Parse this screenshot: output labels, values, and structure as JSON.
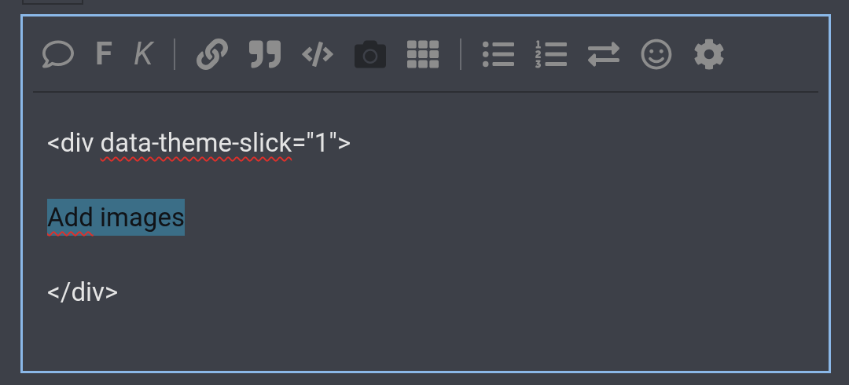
{
  "toolbar": [
    {
      "kind": "icon",
      "disabled": false
    },
    {
      "kind": "letter",
      "label": "F",
      "disabled": false
    },
    {
      "kind": "letter",
      "label": "K",
      "disabled": false
    },
    {
      "kind": "separator"
    },
    {
      "kind": "icon",
      "disabled": false
    },
    {
      "kind": "icon",
      "disabled": false
    },
    {
      "kind": "icon",
      "disabled": false
    },
    {
      "kind": "icon",
      "disabled": true
    },
    {
      "kind": "icon",
      "disabled": false
    },
    {
      "kind": "separator"
    },
    {
      "kind": "icon",
      "disabled": false
    },
    {
      "kind": "icon",
      "disabled": false
    },
    {
      "kind": "icon",
      "disabled": false
    },
    {
      "kind": "icon",
      "disabled": false
    },
    {
      "kind": "icon",
      "disabled": false
    }
  ],
  "editor": {
    "focused": true,
    "lines": [
      {
        "highlighted": false,
        "segments": [
          {
            "text": "<div ",
            "misspelled": false
          },
          {
            "text": "data-theme-slick",
            "misspelled": true
          },
          {
            "text": "=\"1\">",
            "misspelled": false
          }
        ]
      },
      {
        "highlighted": true,
        "segments": [
          {
            "text": "Add",
            "misspelled": true
          },
          {
            "text": " images",
            "misspelled": false
          }
        ]
      },
      {
        "highlighted": false,
        "segments": [
          {
            "text": "</div>",
            "misspelled": false
          }
        ]
      }
    ]
  }
}
